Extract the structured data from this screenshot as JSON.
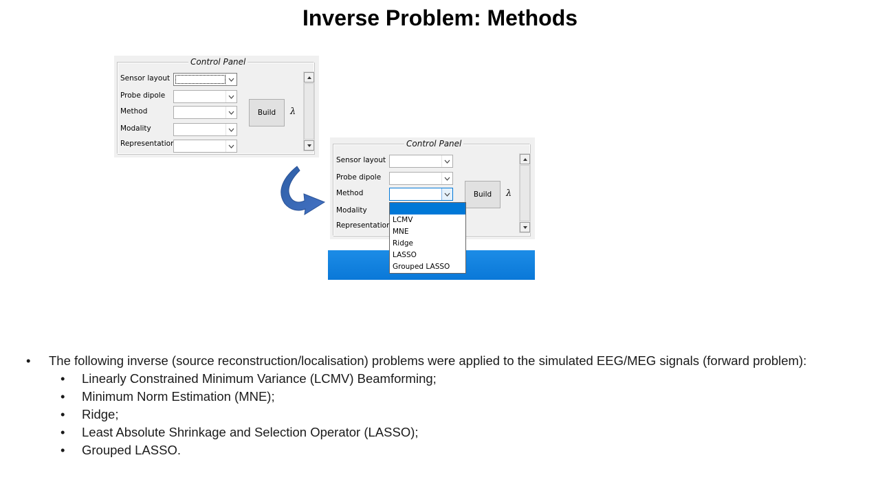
{
  "slide": {
    "title": "Inverse Problem: Methods"
  },
  "panel": {
    "legend": "Control Panel",
    "rows": [
      {
        "label": "Sensor layout"
      },
      {
        "label": "Probe dipole"
      },
      {
        "label": "Method"
      },
      {
        "label": "Modality"
      },
      {
        "label": "Representation"
      }
    ],
    "build_label": "Build",
    "lambda_symbol": "λ"
  },
  "dropdown": {
    "selected_value": "",
    "options": [
      "",
      "LCMV",
      "MNE",
      "Ridge",
      "LASSO",
      "Grouped LASSO"
    ]
  },
  "bullets": {
    "intro": "The following inverse (source reconstruction/localisation) problems were applied to the simulated EEG/MEG signals (forward problem):",
    "items": [
      "Linearly Constrained Minimum Variance (LCMV) Beamforming;",
      "Minimum Norm Estimation (MNE);",
      "Ridge;",
      "Least Absolute Shrinkage and Selection Operator (LASSO);",
      "Grouped LASSO."
    ],
    "bullet_char": "•"
  },
  "colors": {
    "arrow": "#2f5ea8",
    "highlight": "#0078d7",
    "band": "#0a78d8"
  },
  "icons": {
    "arrow": "curved-arrow-icon",
    "combo": "chevron-down-icon"
  }
}
